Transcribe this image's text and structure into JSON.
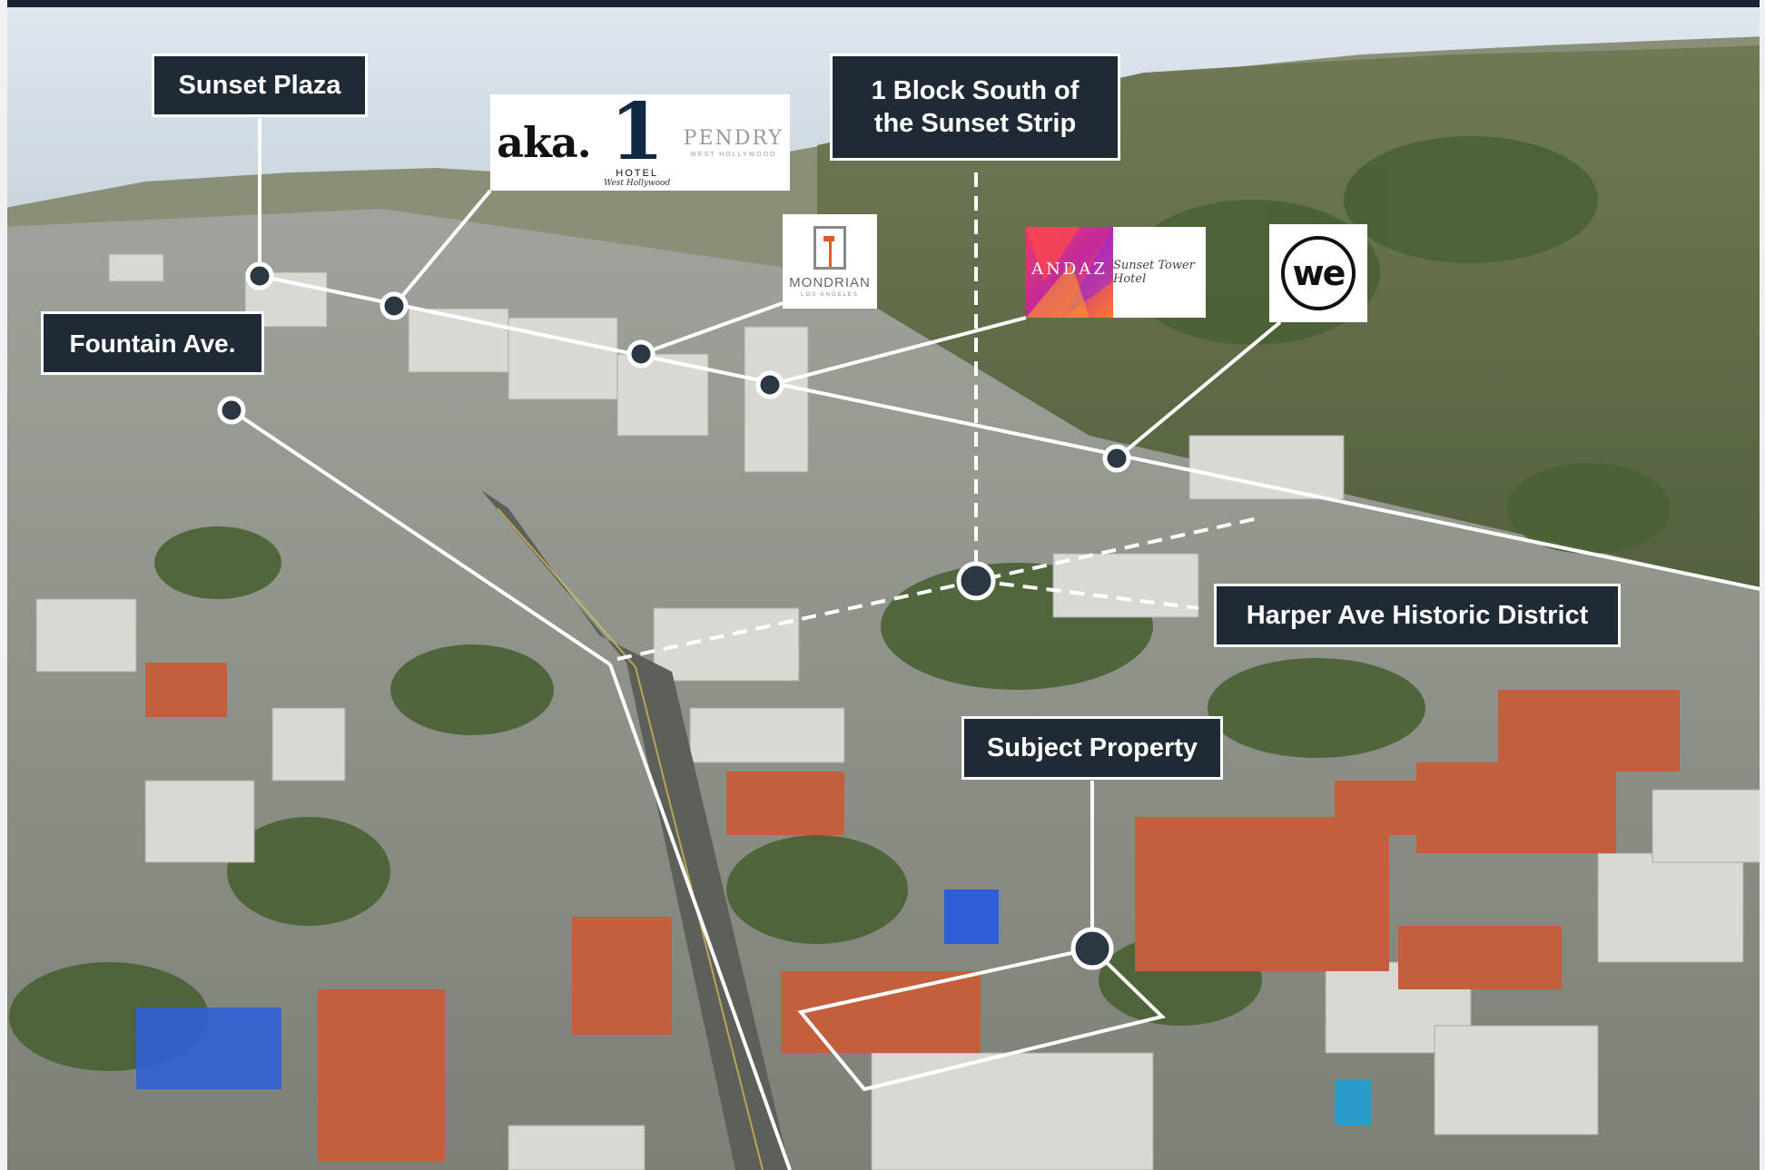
{
  "labels": {
    "sunset_plaza": "Sunset Plaza",
    "fountain_ave": "Fountain Ave.",
    "block_south_line1": "1 Block South of",
    "block_south_line2": "the Sunset Strip",
    "harper_ave": "Harper Ave Historic District",
    "subject_property": "Subject Property"
  },
  "logos": {
    "aka": "aka.",
    "one_hotel_numeral": "1",
    "one_hotel_word": "HOTEL",
    "one_hotel_script": "West Hollywood",
    "pendry": "PENDRY",
    "pendry_sub": "WEST HOLLYWOOD",
    "mondrian": "MONDRIAN",
    "mondrian_sub": "LOS ANGELES",
    "andaz": "ANDAZ",
    "sunset_tower": "Sunset Tower Hotel",
    "wework": "we"
  },
  "colors": {
    "label_bg": "#1f2a35",
    "label_text": "#ffffff",
    "line": "#ffffff",
    "marker_fill": "#2b3844"
  }
}
